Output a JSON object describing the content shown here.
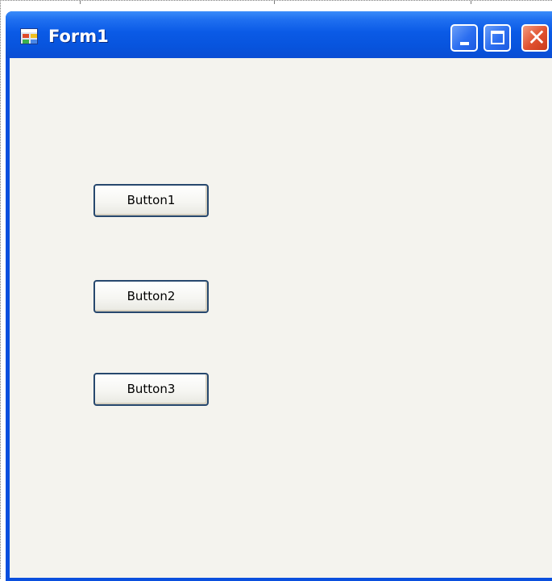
{
  "window": {
    "title": "Form1",
    "icon": "winforms-app-icon",
    "titlebar_color": "#0a5ae6",
    "client_color": "#f4f3ee"
  },
  "caption_buttons": {
    "minimize_icon": "minimize-icon",
    "maximize_icon": "maximize-icon",
    "close_icon": "close-icon",
    "close_glyph": "✕"
  },
  "buttons": [
    {
      "label": "Button1"
    },
    {
      "label": "Button2"
    },
    {
      "label": "Button3"
    }
  ]
}
